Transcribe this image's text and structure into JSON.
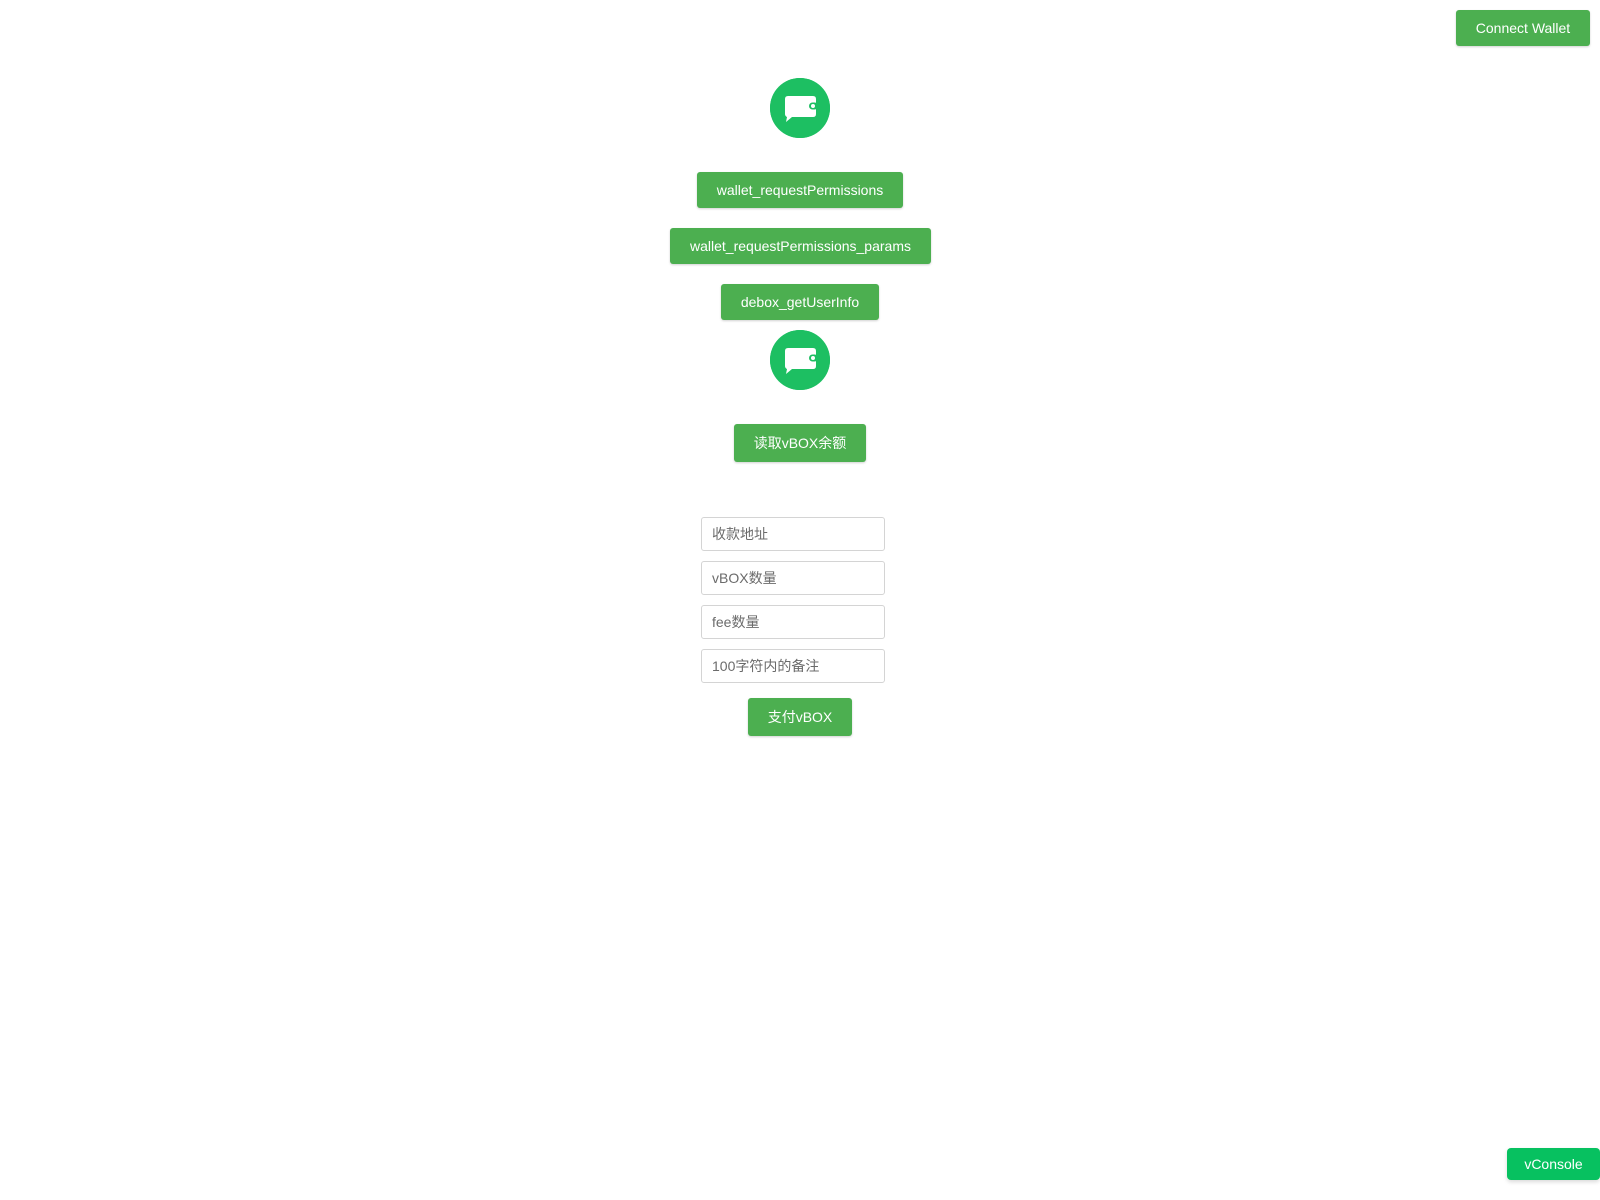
{
  "header": {
    "connect_wallet_label": "Connect Wallet"
  },
  "logo": {
    "icon": "wallet-chat-icon",
    "color": "#1dbf62"
  },
  "actions": {
    "request_permissions_label": "wallet_requestPermissions",
    "request_permissions_params_label": "wallet_requestPermissions_params",
    "get_user_info_label": "debox_getUserInfo",
    "read_balance_label": "读取vBOX余额"
  },
  "payment_form": {
    "address_placeholder": "收款地址",
    "amount_placeholder": "vBOX数量",
    "fee_placeholder": "fee数量",
    "memo_placeholder": "100字符内的备注",
    "pay_label": "支付vBOX"
  },
  "vconsole": {
    "label": "vConsole"
  },
  "colors": {
    "button_green": "#4caf50",
    "logo_green": "#1dbf62",
    "vconsole_green": "#07c160"
  }
}
